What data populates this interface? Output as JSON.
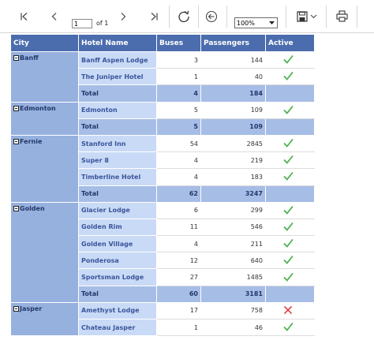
{
  "toolbar": {
    "page_value": "1",
    "page_of": "of 1",
    "zoom_value": "100%"
  },
  "colors": {
    "header_bg": "#4c6dad",
    "city_bg": "#96b1de",
    "hotel_bg": "#c9daf6",
    "total_bg": "#a6bde6",
    "check_green": "#4fb24f",
    "cross_red": "#e04545"
  },
  "report": {
    "columns": [
      "City",
      "Hotel Name",
      "Buses",
      "Passengers",
      "Active"
    ],
    "groups": [
      {
        "city": "Banff",
        "rows": [
          {
            "hotel": "Banff Aspen Lodge",
            "buses": "3",
            "passengers": "144",
            "active": "check-icon"
          },
          {
            "hotel": "The Juniper Hotel",
            "buses": "1",
            "passengers": "40",
            "active": "check-icon"
          }
        ],
        "total": {
          "label": "Total",
          "buses": "4",
          "passengers": "184"
        }
      },
      {
        "city": "Edmonton",
        "rows": [
          {
            "hotel": "Edmonton",
            "buses": "5",
            "passengers": "109",
            "active": "check-icon"
          }
        ],
        "total": {
          "label": "Total",
          "buses": "5",
          "passengers": "109"
        }
      },
      {
        "city": "Fernie",
        "rows": [
          {
            "hotel": "Stanford Inn",
            "buses": "54",
            "passengers": "2845",
            "active": "check-icon"
          },
          {
            "hotel": "Super 8",
            "buses": "4",
            "passengers": "219",
            "active": "check-icon"
          },
          {
            "hotel": "Timberline Hotel",
            "buses": "4",
            "passengers": "183",
            "active": "check-icon"
          }
        ],
        "total": {
          "label": "Total",
          "buses": "62",
          "passengers": "3247"
        }
      },
      {
        "city": "Golden",
        "rows": [
          {
            "hotel": "Glacier Lodge",
            "buses": "6",
            "passengers": "299",
            "active": "check-icon"
          },
          {
            "hotel": "Golden Rim",
            "buses": "11",
            "passengers": "546",
            "active": "check-icon"
          },
          {
            "hotel": "Golden Village",
            "buses": "4",
            "passengers": "211",
            "active": "check-icon"
          },
          {
            "hotel": "Ponderosa",
            "buses": "12",
            "passengers": "640",
            "active": "check-icon"
          },
          {
            "hotel": "Sportsman Lodge",
            "buses": "27",
            "passengers": "1485",
            "active": "check-icon"
          }
        ],
        "total": {
          "label": "Total",
          "buses": "60",
          "passengers": "3181"
        }
      },
      {
        "city": "Jasper",
        "rows": [
          {
            "hotel": "Amethyst Lodge",
            "buses": "17",
            "passengers": "758",
            "active": "cross-icon"
          },
          {
            "hotel": "Chateau Jasper",
            "buses": "1",
            "passengers": "46",
            "active": "check-icon"
          }
        ],
        "total": null
      }
    ]
  }
}
